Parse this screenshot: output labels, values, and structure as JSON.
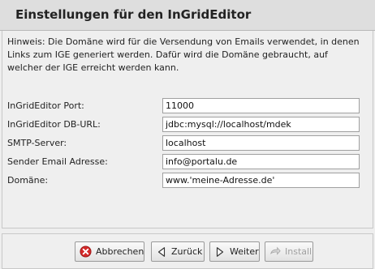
{
  "header": {
    "title": "Einstellungen für den InGridEditor"
  },
  "hint": {
    "text": "Hinweis: Die Domäne wird für die Versendung von Emails verwendet, in denen Links zum IGE generiert werden. Dafür wird die Domäne gebraucht, auf welcher der IGE erreicht werden kann."
  },
  "form": {
    "fields": [
      {
        "label": "InGridEditor Port:",
        "value": "11000"
      },
      {
        "label": "InGridEditor DB-URL:",
        "value": "jdbc:mysql://localhost/mdek"
      },
      {
        "label": "SMTP-Server:",
        "value": "localhost"
      },
      {
        "label": "Sender Email Adresse:",
        "value": "info@portalu.de"
      },
      {
        "label": "Domäne:",
        "value": "www.'meine-Adresse.de'"
      }
    ]
  },
  "buttons": {
    "cancel": {
      "label": "Abbrechen",
      "icon": "cancel-icon",
      "color": "#cc2222"
    },
    "back": {
      "label": "Zurück",
      "icon": "arrow-left-icon"
    },
    "next": {
      "label": "Weiter",
      "icon": "arrow-right-icon"
    },
    "install": {
      "label": "Install",
      "icon": "install-icon",
      "enabled": false
    }
  }
}
